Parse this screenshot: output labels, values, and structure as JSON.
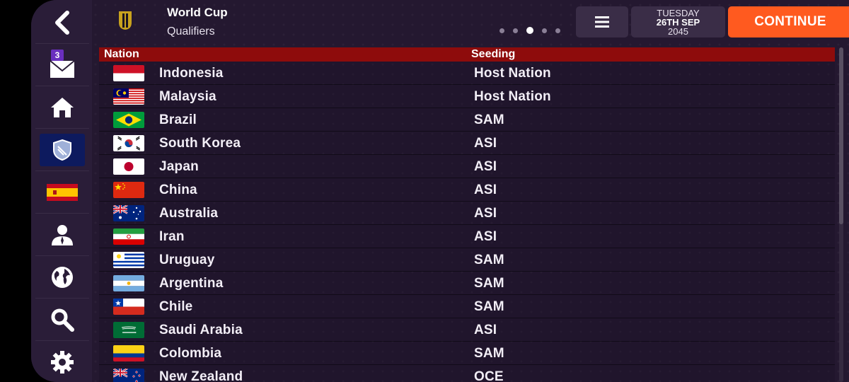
{
  "header": {
    "title": "World Cup",
    "subtitle": "Qualifiers",
    "date_day": "TUESDAY",
    "date_date": "26TH SEP",
    "date_year": "2045",
    "continue_label": "CONTINUE",
    "page_dots": 5,
    "active_dot": 3
  },
  "sidebar": {
    "mail_count": "3",
    "items": [
      "back-icon",
      "mail-icon",
      "home-icon",
      "competition-shield-icon",
      "spain-flag-icon",
      "manager-icon",
      "globe-icon",
      "search-icon",
      "settings-icon"
    ]
  },
  "table": {
    "headers": {
      "nation": "Nation",
      "seeding": "Seeding"
    },
    "rows": [
      {
        "nation": "Indonesia",
        "seeding": "Host Nation",
        "flag": "indonesia"
      },
      {
        "nation": "Malaysia",
        "seeding": "Host Nation",
        "flag": "malaysia"
      },
      {
        "nation": "Brazil",
        "seeding": "SAM",
        "flag": "brazil"
      },
      {
        "nation": "South Korea",
        "seeding": "ASI",
        "flag": "south-korea"
      },
      {
        "nation": "Japan",
        "seeding": "ASI",
        "flag": "japan"
      },
      {
        "nation": "China",
        "seeding": "ASI",
        "flag": "china"
      },
      {
        "nation": "Australia",
        "seeding": "ASI",
        "flag": "australia"
      },
      {
        "nation": "Iran",
        "seeding": "ASI",
        "flag": "iran"
      },
      {
        "nation": "Uruguay",
        "seeding": "SAM",
        "flag": "uruguay"
      },
      {
        "nation": "Argentina",
        "seeding": "SAM",
        "flag": "argentina"
      },
      {
        "nation": "Chile",
        "seeding": "SAM",
        "flag": "chile"
      },
      {
        "nation": "Saudi Arabia",
        "seeding": "ASI",
        "flag": "saudi-arabia"
      },
      {
        "nation": "Colombia",
        "seeding": "SAM",
        "flag": "colombia"
      },
      {
        "nation": "New Zealand",
        "seeding": "OCE",
        "flag": "new-zealand"
      }
    ]
  },
  "colors": {
    "accent": "#ff5a1f",
    "header_row": "#8e0c0c",
    "background": "#241830"
  }
}
